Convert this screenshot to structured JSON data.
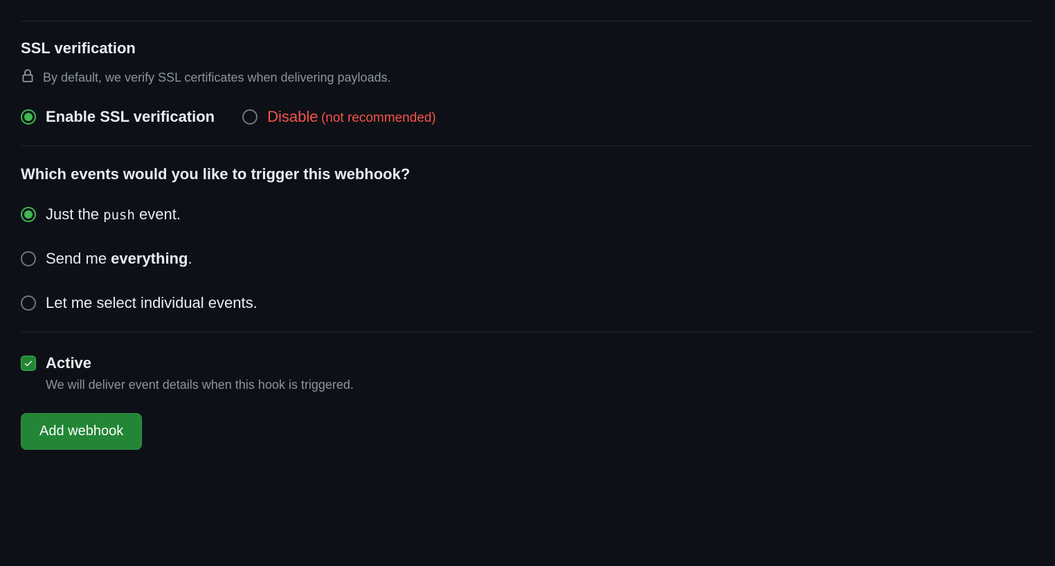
{
  "ssl": {
    "heading": "SSL verification",
    "description": "By default, we verify SSL certificates when delivering payloads.",
    "options": {
      "enable": "Enable SSL verification",
      "disable_main": "Disable",
      "disable_sub": "(not recommended)"
    }
  },
  "events": {
    "heading": "Which events would you like to trigger this webhook?",
    "options": {
      "just_push_pre": "Just the ",
      "just_push_code": "push",
      "just_push_post": " event.",
      "everything_pre": "Send me ",
      "everything_bold": "everything",
      "everything_post": ".",
      "individual": "Let me select individual events."
    }
  },
  "active": {
    "label": "Active",
    "description": "We will deliver event details when this hook is triggered."
  },
  "submit": {
    "label": "Add webhook"
  }
}
